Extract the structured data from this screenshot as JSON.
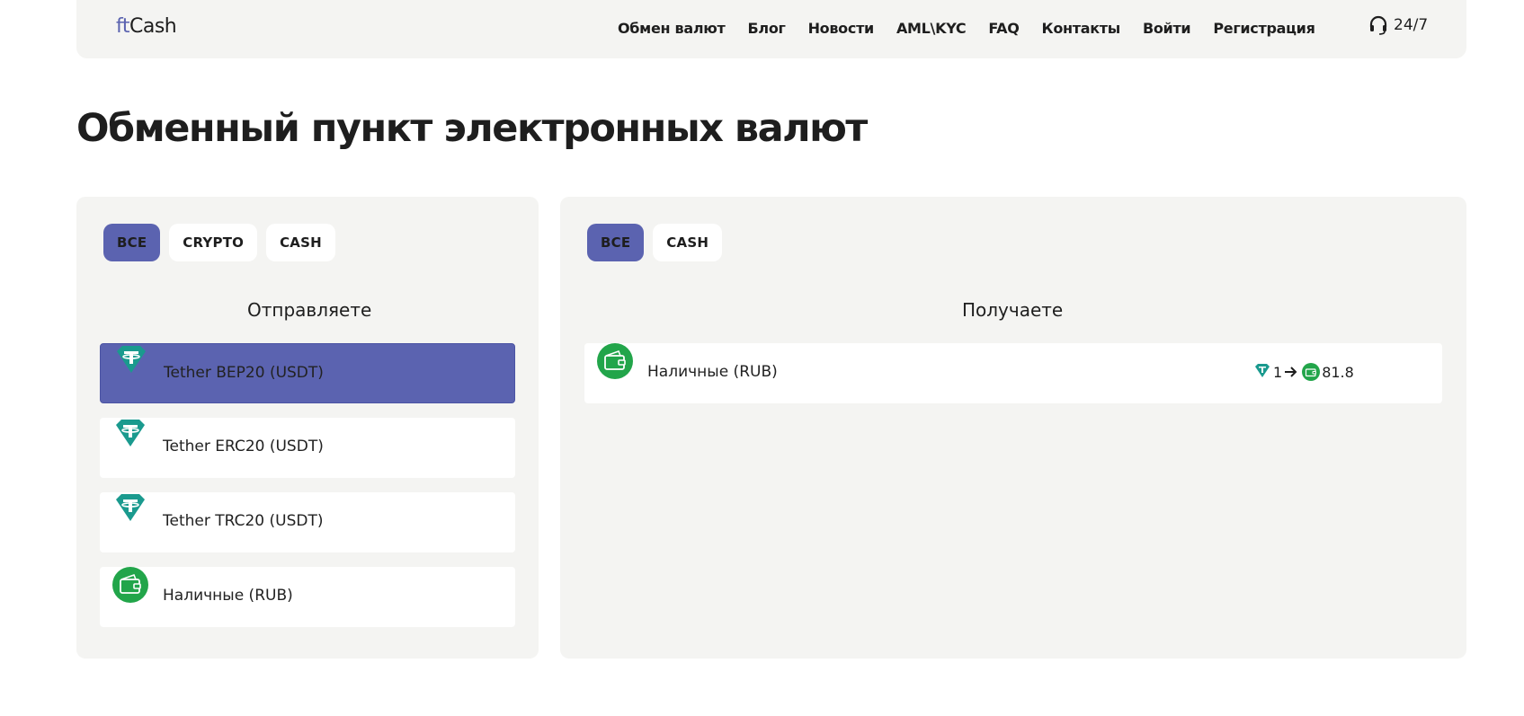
{
  "header": {
    "logo_prefix": "ft",
    "logo_suffix": "Cash",
    "nav": [
      "Обмен валют",
      "Блог",
      "Новости",
      "AML\\KYC",
      "FAQ",
      "Контакты",
      "Войти",
      "Регистрация"
    ],
    "support_label": "24/7",
    "support_icon": "headset-icon"
  },
  "page_title": "Обменный пункт электронных валют",
  "send_panel": {
    "filters": [
      "ВСЕ",
      "CRYPTO",
      "CASH"
    ],
    "active_filter": "ВСЕ",
    "title": "Отправляете",
    "items": [
      {
        "label": "Tether BEP20 (USDT)",
        "icon": "tether-icon",
        "selected": true
      },
      {
        "label": "Tether ERC20 (USDT)",
        "icon": "tether-icon",
        "selected": false
      },
      {
        "label": "Tether TRC20 (USDT)",
        "icon": "tether-icon",
        "selected": false
      },
      {
        "label": "Наличные (RUB)",
        "icon": "wallet-icon",
        "selected": false
      }
    ]
  },
  "receive_panel": {
    "filters": [
      "ВСЕ",
      "CASH"
    ],
    "active_filter": "ВСЕ",
    "title": "Получаете",
    "items": [
      {
        "label": "Наличные (RUB)",
        "icon": "wallet-icon",
        "rate_from": "1",
        "rate_to": "81.8"
      }
    ]
  },
  "colors": {
    "accent": "#5b63b0",
    "panel_bg": "#f4f4f2",
    "tether": "#1a9a8e",
    "wallet": "#22a54a"
  }
}
